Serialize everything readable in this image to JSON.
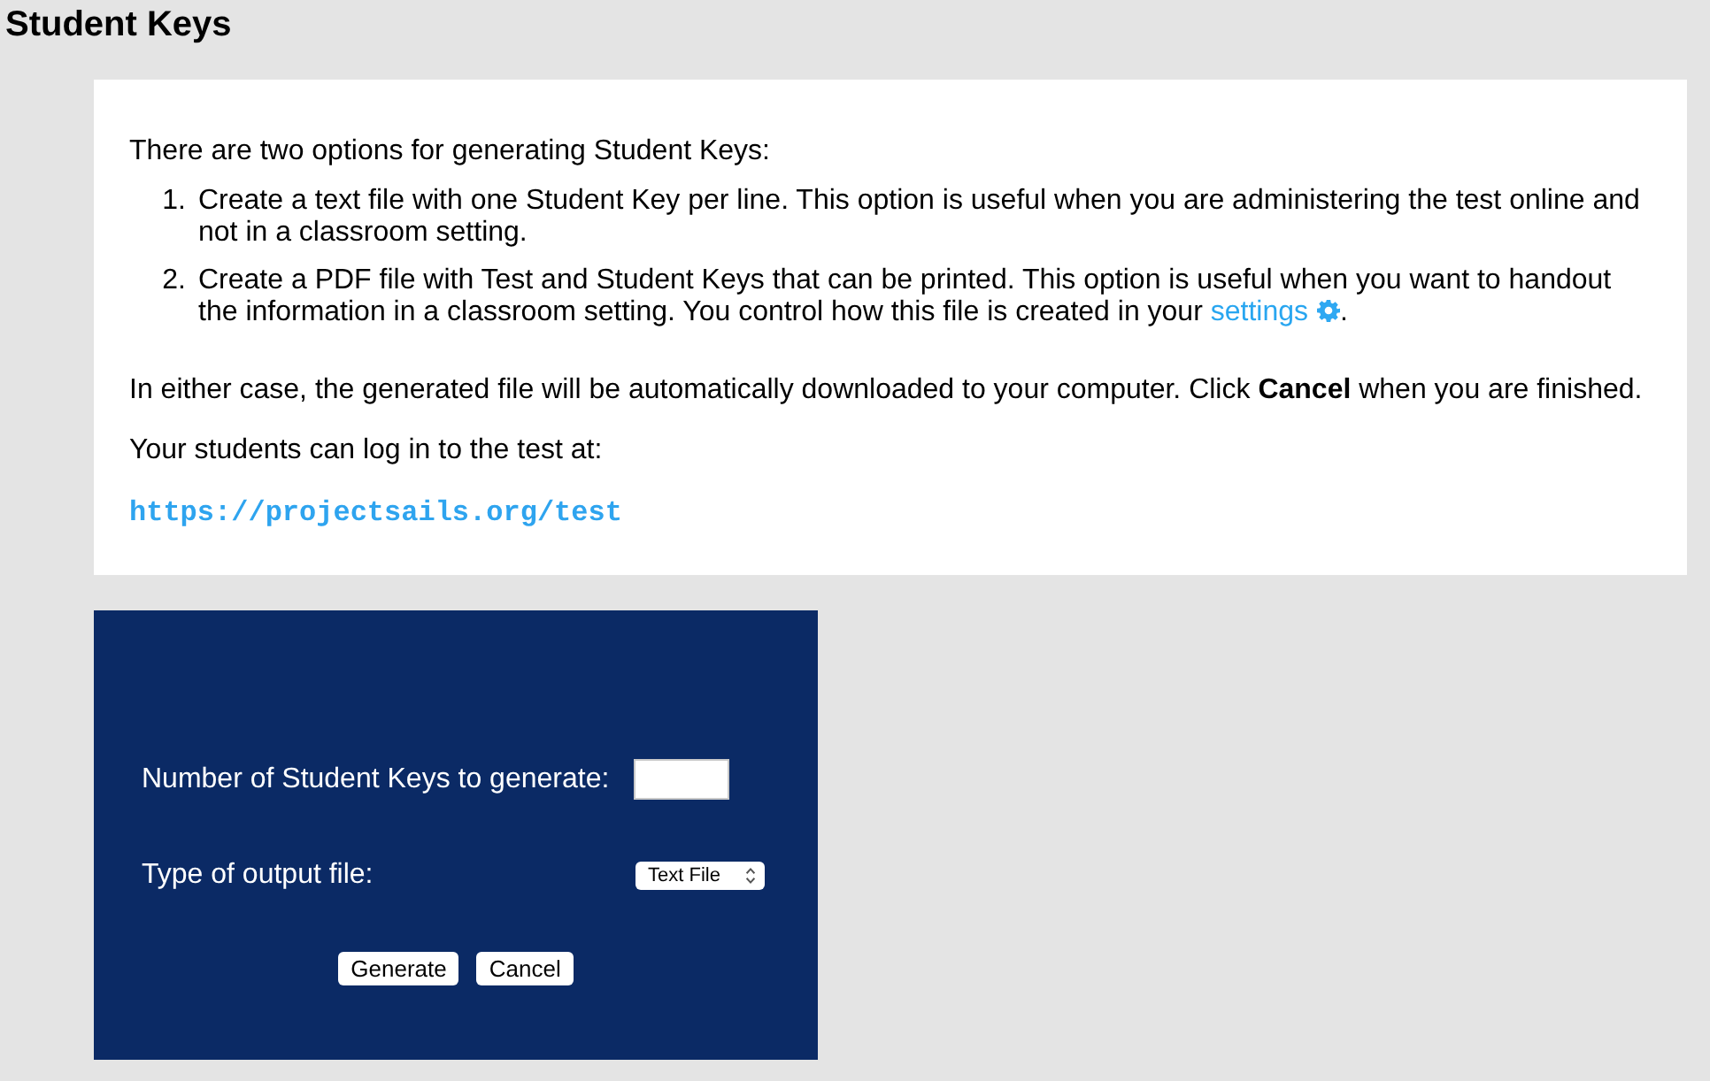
{
  "page_title": "Student Keys",
  "intro": {
    "lead": "There are two options for generating Student Keys:",
    "options": [
      {
        "number": "1.",
        "text": "Create a text file with one Student Key per line. This option is useful when you are administering the test online and not in a classroom setting."
      },
      {
        "number": "2.",
        "text": "Create a PDF file with Test and Student Keys that can be printed. This option is useful when you want to handout the information in a classroom setting. You control how this file is created in your ",
        "link": "settings",
        "after": "."
      }
    ],
    "note": "In either case, the generated file will be automatically downloaded to your computer. Click **Cancel** when you are finished.",
    "login_prompt": "Your students can log in to the test at:",
    "login_url": "https://projectsails.org/test"
  },
  "form": {
    "fields": [
      {
        "kind": "number",
        "label": "Number of Student Keys to generate:"
      },
      {
        "kind": "select",
        "label": "Type of output file:",
        "value": "Text File"
      }
    ],
    "buttons": [
      "Generate",
      "Cancel"
    ]
  }
}
